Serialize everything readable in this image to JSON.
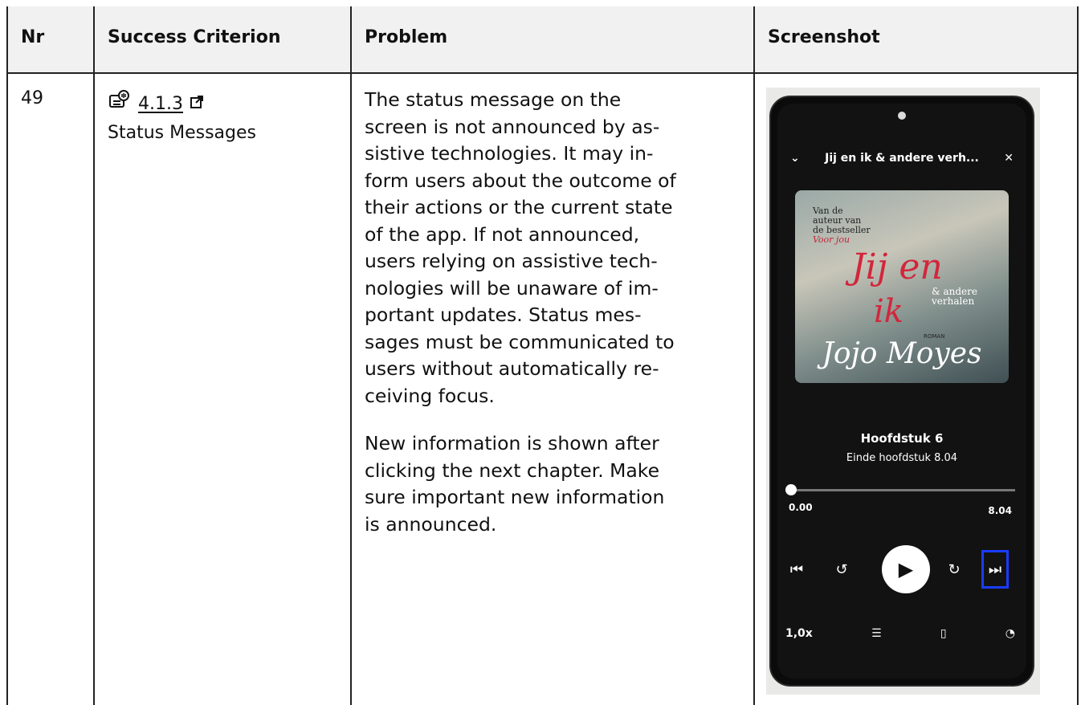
{
  "table": {
    "headers": [
      "Nr",
      "Success Criterion",
      "Problem",
      "Screenshot"
    ],
    "row": {
      "nr": "49",
      "criterion": {
        "code": "4.1.3",
        "name": "Status Messages"
      },
      "problem": {
        "paragraph1_lines": [
          "The status message on the",
          "screen is not announced by as-",
          "sistive technologies. It may in-",
          "form users about the outcome of",
          "their actions or the current state",
          "of the app. If not announced,",
          "users relying on assistive tech-",
          "nologies will be unaware of im-",
          "portant updates. Status mes-",
          "sages must be communicated to",
          "users without automatically re-",
          "ceiving focus."
        ],
        "paragraph2_lines": [
          "New information is shown after",
          "clicking the next chapter. Make",
          "sure important new information",
          "is announced."
        ]
      },
      "screenshot": {
        "header_title": "Jij en ik & andere verh...",
        "cover": {
          "small_lines": [
            "Van de",
            "auteur van",
            "de bestseller"
          ],
          "small_red": "Voor jou",
          "title_1": "Jij en",
          "title_2": "ik",
          "subtitle": "& andere verhalen",
          "roman": "ROMAN",
          "author": "Jojo Moyes"
        },
        "chapter": "Hoofdstuk 6",
        "chapter_end": "Einde hoofdstuk 8.04",
        "progress": 0.0,
        "time_start": "0.00",
        "time_end": "8.04",
        "speed": "1,0x",
        "focus_color": "#1a3cff"
      }
    }
  }
}
